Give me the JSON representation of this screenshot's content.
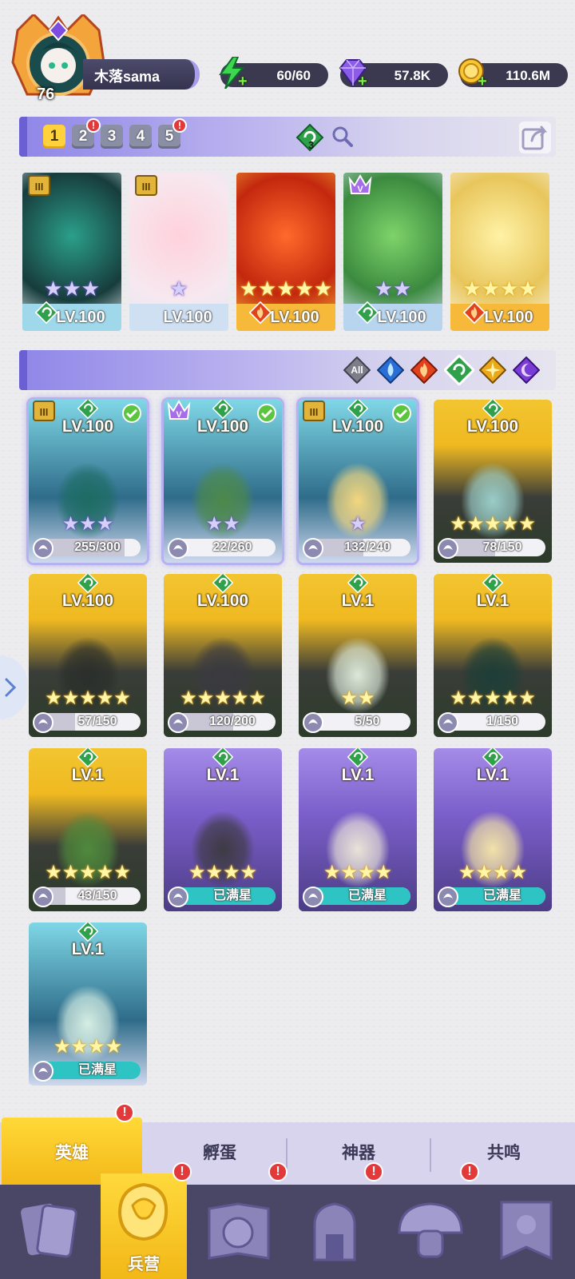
{
  "player": {
    "level": "76",
    "name": "木落sama"
  },
  "resources": {
    "energy": "60/60",
    "gems": "57.8K",
    "gold": "110.6M"
  },
  "teams": {
    "tabs": [
      "1",
      "2",
      "3",
      "4",
      "5"
    ],
    "active": "1",
    "badges": [
      "2",
      "5"
    ],
    "member_count": "3"
  },
  "lineup": [
    {
      "level": "LV.100",
      "element": "wind",
      "rank": "III",
      "stars": 3,
      "star_color": "purple",
      "theme": "#9fd8ea"
    },
    {
      "level": "LV.100",
      "element": "none",
      "rank": "III",
      "stars": 1,
      "star_color": "purple",
      "theme": "#cfe0f3"
    },
    {
      "level": "LV.100",
      "element": "fire",
      "rank": "",
      "stars": 5,
      "star_color": "gold",
      "theme": "#f7b93a"
    },
    {
      "level": "LV.100",
      "element": "wind",
      "rank": "V",
      "stars": 2,
      "star_color": "purple",
      "theme": "#b8d5ef"
    },
    {
      "level": "LV.100",
      "element": "fire",
      "rank": "",
      "stars": 4,
      "star_color": "gold",
      "theme": "#f7b93a"
    }
  ],
  "filters": {
    "all_label": "All",
    "items": [
      "all",
      "water",
      "fire",
      "wind",
      "light",
      "dark"
    ],
    "selected": "wind"
  },
  "heroes": [
    {
      "level": "LV.100",
      "rank": "III",
      "checked": true,
      "stars": 3,
      "star_color": "purple",
      "shards": "255/300",
      "progress": 0.85,
      "bg": "blue"
    },
    {
      "level": "LV.100",
      "rank": "V",
      "checked": true,
      "stars": 2,
      "star_color": "purple",
      "shards": "22/260",
      "progress": 0.08,
      "bg": "blue"
    },
    {
      "level": "LV.100",
      "rank": "III",
      "checked": true,
      "stars": 1,
      "star_color": "purple",
      "shards": "132/240",
      "progress": 0.55,
      "bg": "blue"
    },
    {
      "level": "LV.100",
      "rank": "",
      "checked": false,
      "stars": 5,
      "star_color": "gold",
      "shards": "78/150",
      "progress": 0.52,
      "bg": "gold"
    },
    {
      "level": "LV.100",
      "rank": "",
      "checked": false,
      "stars": 5,
      "star_color": "gold",
      "shards": "57/150",
      "progress": 0.38,
      "bg": "gold"
    },
    {
      "level": "LV.100",
      "rank": "",
      "checked": false,
      "stars": 5,
      "star_color": "gold",
      "shards": "120/200",
      "progress": 0.6,
      "bg": "gold"
    },
    {
      "level": "LV.1",
      "rank": "",
      "checked": false,
      "stars": 2,
      "star_color": "gold",
      "shards": "5/50",
      "progress": 0.1,
      "bg": "gold"
    },
    {
      "level": "LV.1",
      "rank": "",
      "checked": false,
      "stars": 5,
      "star_color": "gold",
      "shards": "1/150",
      "progress": 0.01,
      "bg": "gold"
    },
    {
      "level": "LV.1",
      "rank": "",
      "checked": false,
      "stars": 5,
      "star_color": "gold",
      "shards": "43/150",
      "progress": 0.29,
      "bg": "gold"
    },
    {
      "level": "LV.1",
      "rank": "",
      "checked": false,
      "stars": 4,
      "star_color": "gold",
      "shards": "已满星",
      "progress": 1,
      "bg": "purple"
    },
    {
      "level": "LV.1",
      "rank": "",
      "checked": false,
      "stars": 4,
      "star_color": "gold",
      "shards": "已满星",
      "progress": 1,
      "bg": "purple"
    },
    {
      "level": "LV.1",
      "rank": "",
      "checked": false,
      "stars": 4,
      "star_color": "gold",
      "shards": "已满星",
      "progress": 1,
      "bg": "purple"
    },
    {
      "level": "LV.1",
      "rank": "",
      "checked": false,
      "stars": 4,
      "star_color": "gold",
      "shards": "已满星",
      "progress": 1,
      "bg": "blue"
    }
  ],
  "subtabs": [
    "英雄",
    "孵蛋",
    "神器",
    "共鸣"
  ],
  "subtab_active": "英雄",
  "nav": {
    "items": [
      "cards",
      "barracks",
      "book",
      "castle",
      "mushroom",
      "flag"
    ],
    "active_label": "兵营"
  },
  "colors": {
    "accent_gold": "#f7b93a",
    "accent_purple": "#8f86e8",
    "wind_green": "#2fa14b",
    "alert_red": "#e23a3a"
  }
}
